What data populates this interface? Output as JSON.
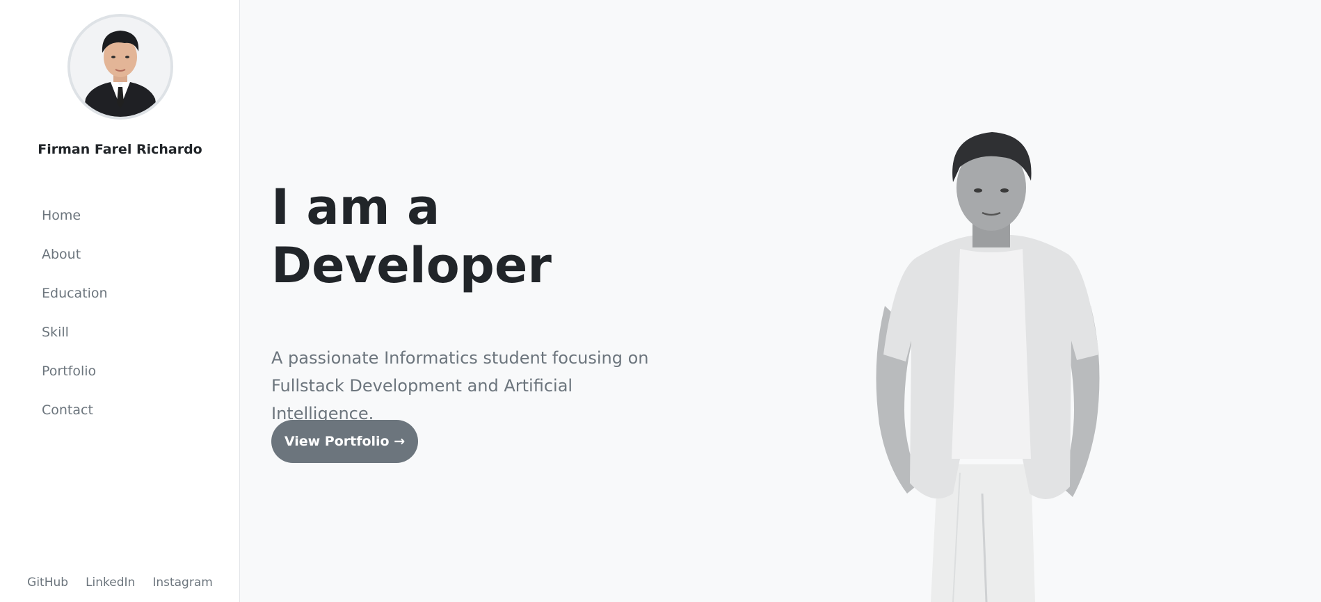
{
  "sidebar": {
    "profile_name": "Firman Farel Richardo",
    "nav": [
      "Home",
      "About",
      "Education",
      "Skill",
      "Portfolio",
      "Contact"
    ],
    "social": [
      "GitHub",
      "LinkedIn",
      "Instagram"
    ]
  },
  "hero": {
    "title_line1": "I am a",
    "title_line2": "Developer",
    "description_line1": "A passionate Informatics student focusing on",
    "description_line2": "Fullstack Development and Artificial Intelligence.",
    "cta_label": "View Portfolio →"
  },
  "colors": {
    "background": "#f8f9fa",
    "sidebar_background": "#ffffff",
    "text_dark": "#212529",
    "text_muted": "#6c757d",
    "button": "#6c757d"
  }
}
